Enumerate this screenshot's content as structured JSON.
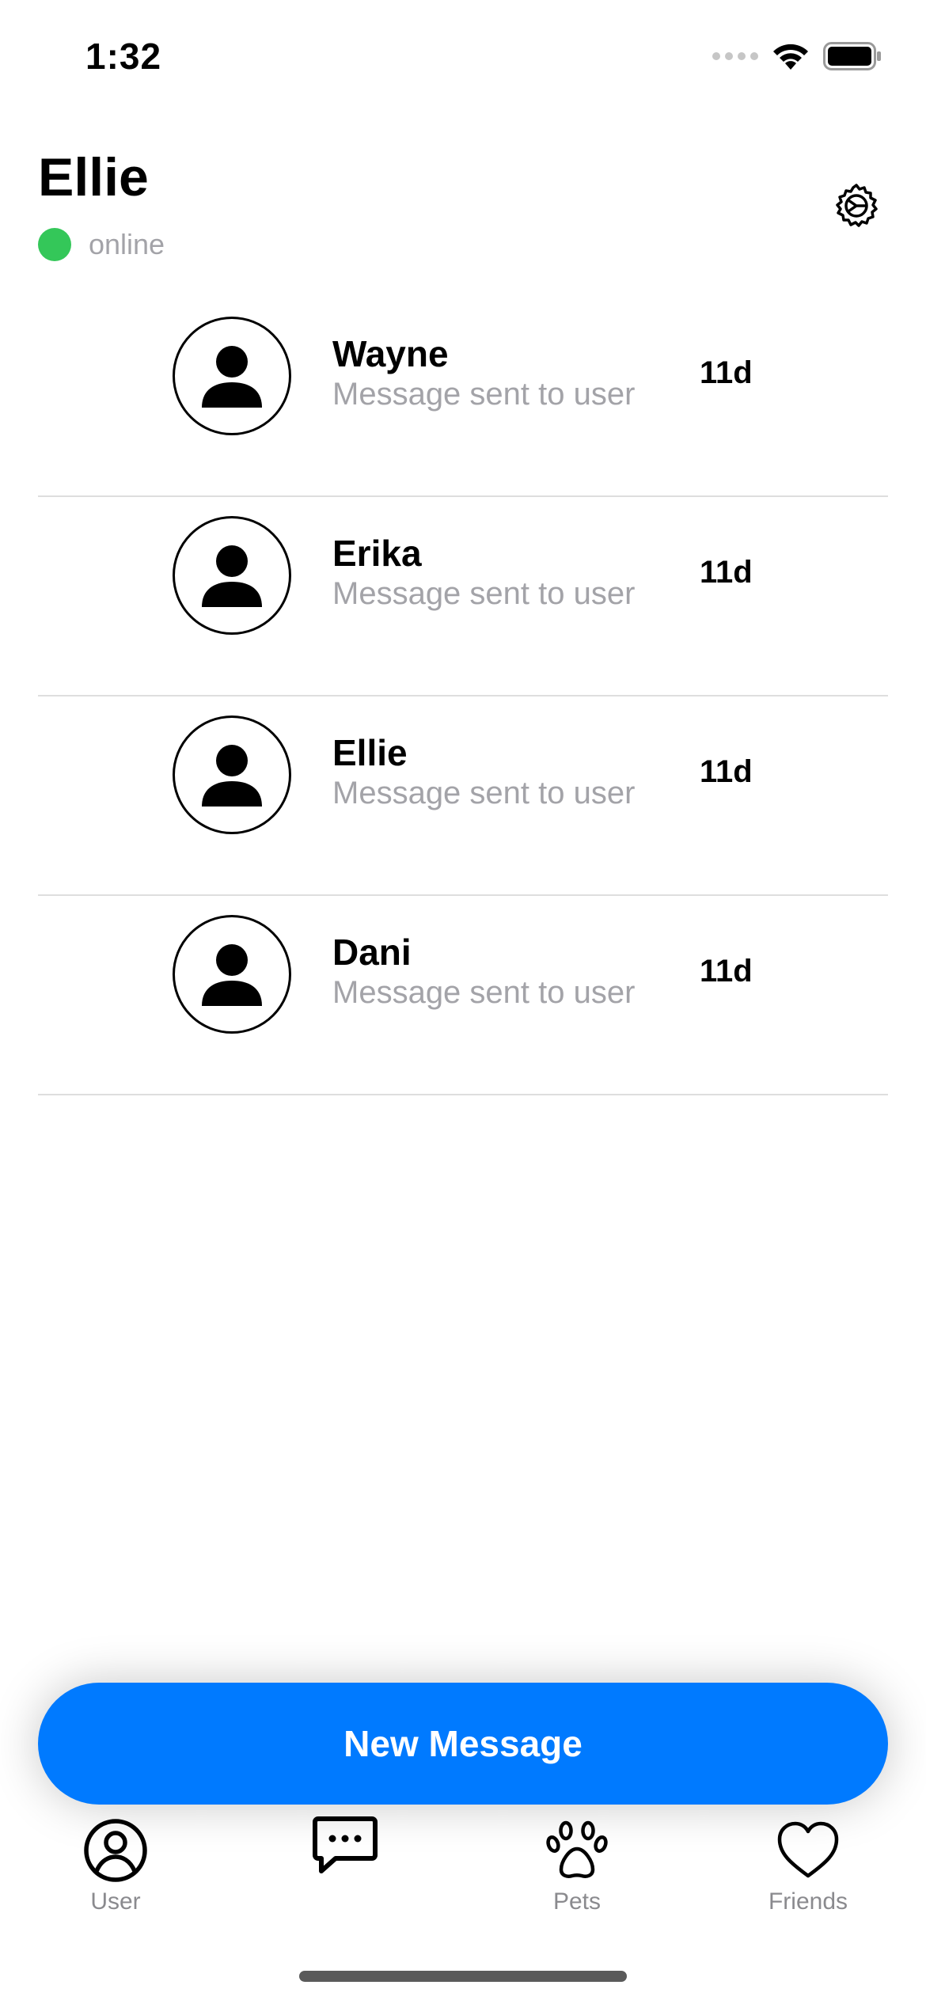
{
  "status_bar": {
    "time": "1:32"
  },
  "header": {
    "title": "Ellie",
    "status": "online",
    "status_color": "#34c759"
  },
  "conversations": [
    {
      "name": "Wayne",
      "preview": "Message sent to user",
      "time": "11d"
    },
    {
      "name": "Erika",
      "preview": "Message sent to user",
      "time": "11d"
    },
    {
      "name": "Ellie",
      "preview": "Message sent to user",
      "time": "11d"
    },
    {
      "name": "Dani",
      "preview": "Message sent to user",
      "time": "11d"
    }
  ],
  "new_message_button": {
    "label": "New Message",
    "color": "#007aff"
  },
  "tabs": [
    {
      "label": "User",
      "icon": "person-circle-icon"
    },
    {
      "label": "",
      "icon": "message-bubble-icon"
    },
    {
      "label": "Pets",
      "icon": "paw-icon"
    },
    {
      "label": "Friends",
      "icon": "heart-icon"
    }
  ]
}
